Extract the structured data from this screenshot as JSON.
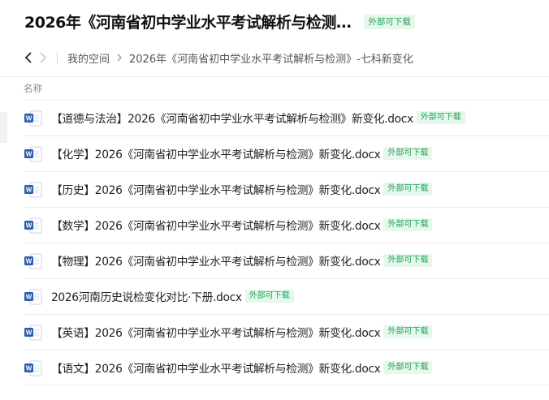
{
  "header": {
    "title": "2026年《河南省初中学业水平考试解析与检测…",
    "badge": "外部可下载"
  },
  "nav": {
    "back_icon": "chevron-left-icon",
    "forward_icon": "chevron-right-icon",
    "breadcrumbs": [
      "我的空间",
      "2026年《河南省初中学业水平考试解析与检测》-七科新变化"
    ]
  },
  "list": {
    "column_header": "名称",
    "files": [
      {
        "name": "【道德与法治】2026《河南省初中学业水平考试解析与检测》新变化.docx",
        "badge": "外部可下载",
        "icon": "word-doc-icon"
      },
      {
        "name": "【化学】2026《河南省初中学业水平考试解析与检测》新变化.docx",
        "badge": "外部可下载",
        "icon": "word-doc-icon"
      },
      {
        "name": "【历史】2026《河南省初中学业水平考试解析与检测》新变化.docx",
        "badge": "外部可下载",
        "icon": "word-doc-icon"
      },
      {
        "name": "【数学】2026《河南省初中学业水平考试解析与检测》新变化.docx",
        "badge": "外部可下载",
        "icon": "word-doc-icon"
      },
      {
        "name": "【物理】2026《河南省初中学业水平考试解析与检测》新变化.docx",
        "badge": "外部可下载",
        "icon": "word-doc-icon"
      },
      {
        "name": "2026河南历史说检变化对比·下册.docx",
        "badge": "外部可下载",
        "icon": "word-doc-icon"
      },
      {
        "name": "【英语】2026《河南省初中学业水平考试解析与检测》新变化.docx",
        "badge": "外部可下载",
        "icon": "word-doc-icon"
      },
      {
        "name": "【语文】2026《河南省初中学业水平考试解析与检测》新变化.docx",
        "badge": "外部可下载",
        "icon": "word-doc-icon"
      }
    ]
  },
  "colors": {
    "badge_bg": "#e6f7ec",
    "badge_text": "#20a35a",
    "word_blue": "#2b5db0"
  }
}
